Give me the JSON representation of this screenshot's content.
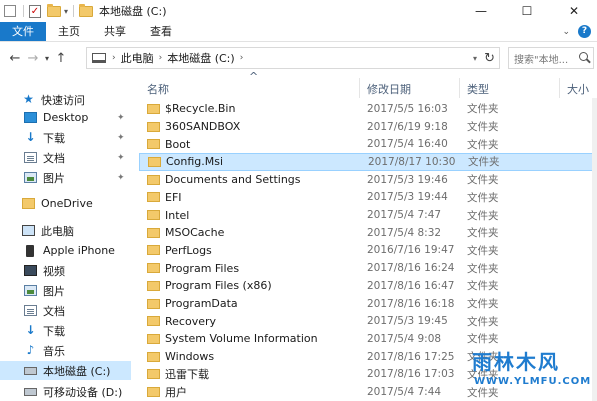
{
  "window": {
    "title": "本地磁盘 (C:)",
    "min_glyph": "—",
    "max_glyph": "☐",
    "close_glyph": "✕"
  },
  "ribbon": {
    "tabs": [
      "文件",
      "主页",
      "共享",
      "查看"
    ]
  },
  "address": {
    "crumbs": [
      "此电脑",
      "本地磁盘 (C:)"
    ],
    "search_placeholder": "搜索\"本地..."
  },
  "sidebar": {
    "items": [
      {
        "label": "快速访问",
        "icon": "star-icon",
        "pinned": false
      },
      {
        "label": "Desktop",
        "icon": "desktop-icon",
        "pinned": true
      },
      {
        "label": "下载",
        "icon": "download-icon",
        "pinned": true
      },
      {
        "label": "文档",
        "icon": "document-icon",
        "pinned": true
      },
      {
        "label": "图片",
        "icon": "picture-icon",
        "pinned": true
      },
      {
        "label": "OneDrive",
        "icon": "folder-icon",
        "pinned": false
      },
      {
        "label": "此电脑",
        "icon": "computer-icon",
        "pinned": false
      },
      {
        "label": "Apple iPhone",
        "icon": "phone-icon",
        "pinned": false
      },
      {
        "label": "视频",
        "icon": "video-icon",
        "pinned": false
      },
      {
        "label": "图片",
        "icon": "picture-icon",
        "pinned": false
      },
      {
        "label": "文档",
        "icon": "document-icon",
        "pinned": false
      },
      {
        "label": "下载",
        "icon": "download-icon",
        "pinned": false
      },
      {
        "label": "音乐",
        "icon": "music-icon",
        "pinned": false
      },
      {
        "label": "本地磁盘 (C:)",
        "icon": "drive-icon",
        "pinned": false,
        "selected": true
      },
      {
        "label": "可移动设备 (D:)",
        "icon": "drive-icon",
        "pinned": false
      }
    ]
  },
  "columns": {
    "name": "名称",
    "date": "修改日期",
    "type": "类型",
    "size": "大小"
  },
  "files": [
    {
      "name": "$Recycle.Bin",
      "date": "2017/5/5 16:03",
      "type": "文件夹"
    },
    {
      "name": "360SANDBOX",
      "date": "2017/6/19 9:18",
      "type": "文件夹"
    },
    {
      "name": "Boot",
      "date": "2017/5/4 16:40",
      "type": "文件夹"
    },
    {
      "name": "Config.Msi",
      "date": "2017/8/17 10:30",
      "type": "文件夹",
      "selected": true
    },
    {
      "name": "Documents and Settings",
      "date": "2017/5/3 19:46",
      "type": "文件夹"
    },
    {
      "name": "EFI",
      "date": "2017/5/3 19:44",
      "type": "文件夹"
    },
    {
      "name": "Intel",
      "date": "2017/5/4 7:47",
      "type": "文件夹"
    },
    {
      "name": "MSOCache",
      "date": "2017/5/4 8:32",
      "type": "文件夹"
    },
    {
      "name": "PerfLogs",
      "date": "2016/7/16 19:47",
      "type": "文件夹"
    },
    {
      "name": "Program Files",
      "date": "2017/8/16 16:24",
      "type": "文件夹"
    },
    {
      "name": "Program Files (x86)",
      "date": "2017/8/16 16:47",
      "type": "文件夹"
    },
    {
      "name": "ProgramData",
      "date": "2017/8/16 16:18",
      "type": "文件夹"
    },
    {
      "name": "Recovery",
      "date": "2017/5/3 19:45",
      "type": "文件夹"
    },
    {
      "name": "System Volume Information",
      "date": "2017/5/4 9:08",
      "type": "文件夹"
    },
    {
      "name": "Windows",
      "date": "2017/8/16 17:25",
      "type": "文件夹"
    },
    {
      "name": "迅雷下载",
      "date": "2017/8/16 17:03",
      "type": "文件夹"
    },
    {
      "name": "用户",
      "date": "2017/5/4 7:44",
      "type": "文件夹"
    }
  ],
  "watermark": {
    "main": "雨林木风",
    "url": "WWW.YLMFU.COM"
  }
}
